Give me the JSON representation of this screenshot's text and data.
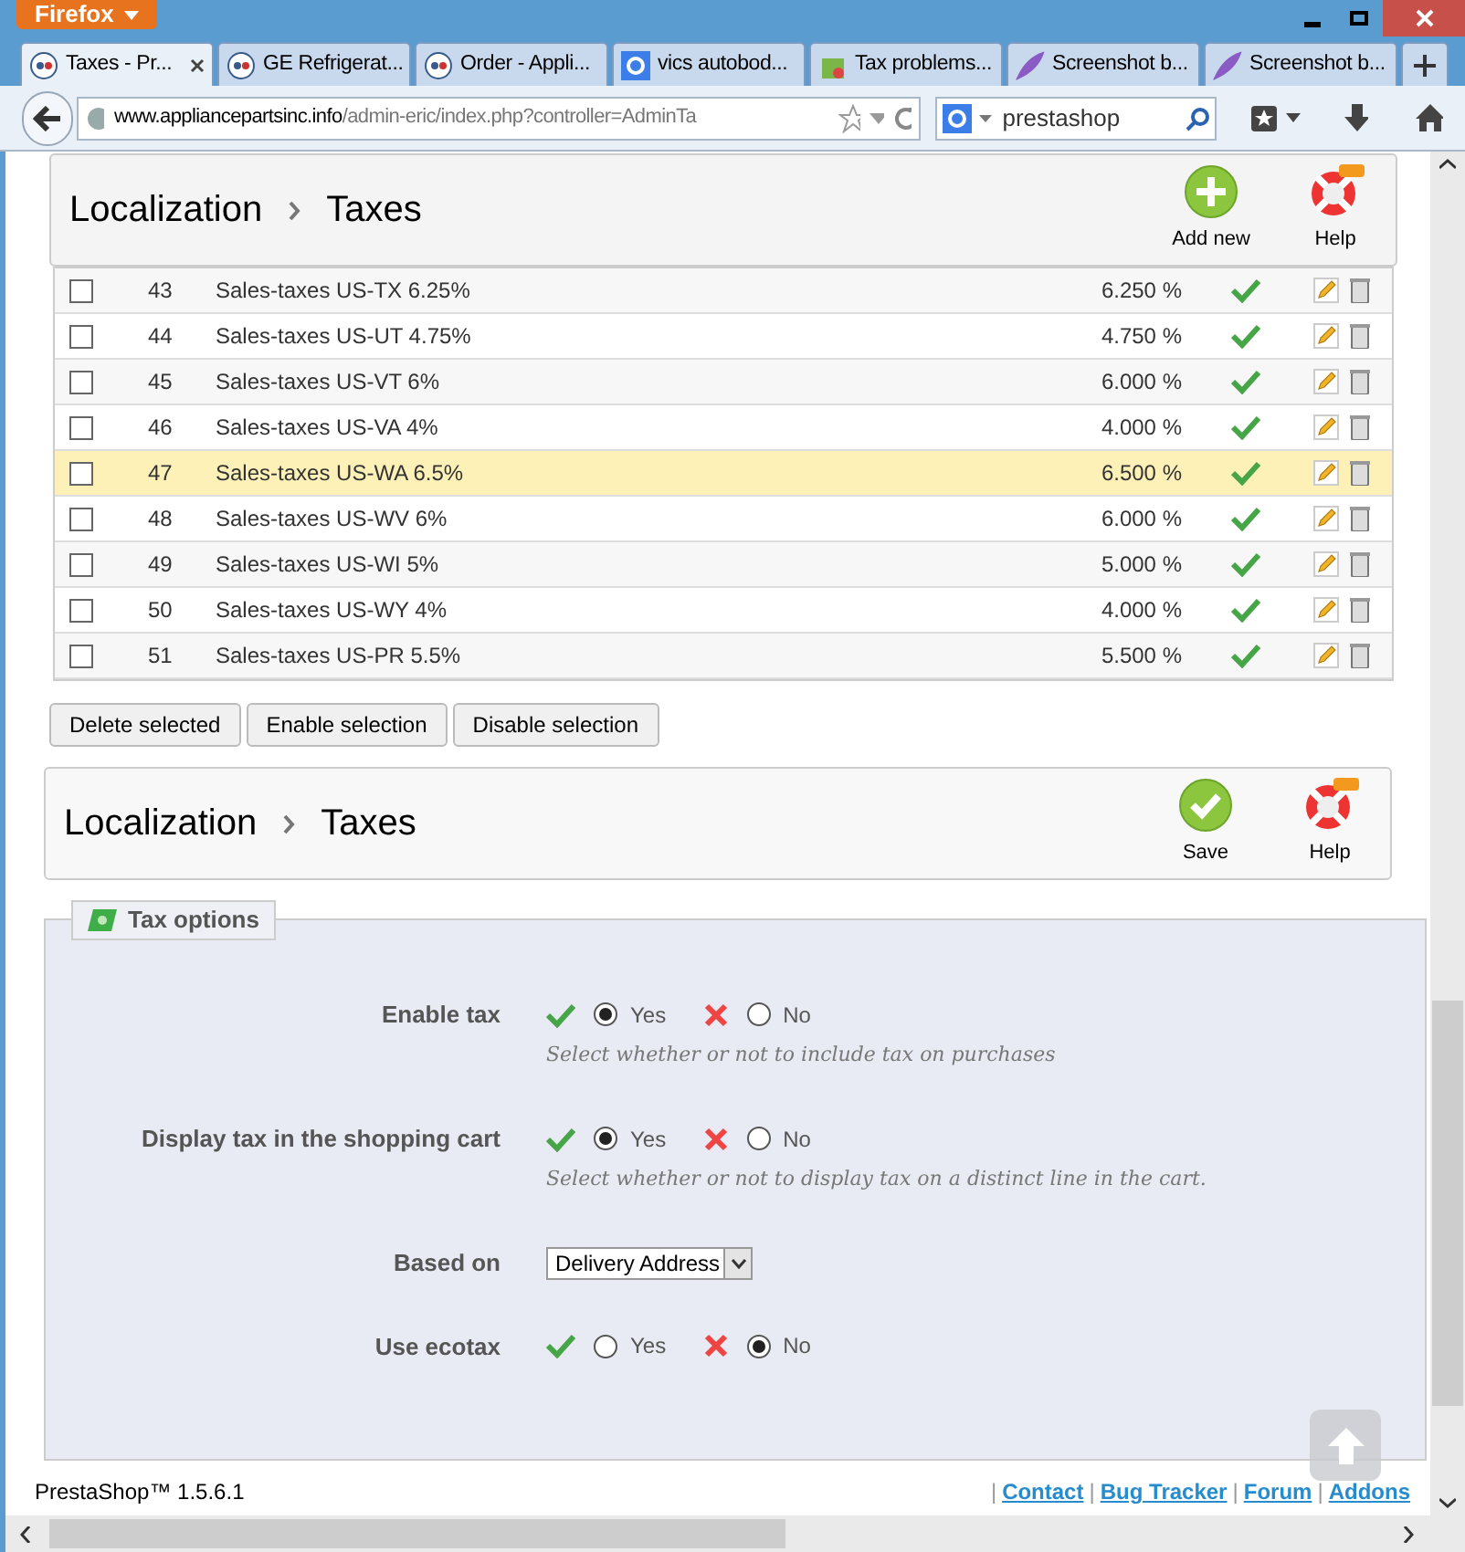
{
  "browser": {
    "menu_button": "Firefox",
    "tabs": [
      {
        "label": "Taxes - Pr...",
        "selected": true
      },
      {
        "label": "GE Refrigerat...",
        "selected": false
      },
      {
        "label": "Order - Appli...",
        "selected": false
      },
      {
        "label": "vics autobod...",
        "selected": false
      },
      {
        "label": "Tax problems...",
        "selected": false
      },
      {
        "label": "Screenshot b...",
        "selected": false
      },
      {
        "label": "Screenshot b...",
        "selected": false
      }
    ],
    "url_host": "www.appliancepartsinc.info",
    "url_path": "/admin-eric/index.php?controller=AdminTa",
    "search": {
      "value": "prestashop"
    }
  },
  "top_header": {
    "breadcrumb": [
      "Localization",
      "Taxes"
    ],
    "actions": [
      {
        "kind": "add",
        "label": "Add new"
      },
      {
        "kind": "help",
        "label": "Help"
      }
    ]
  },
  "table": {
    "rows": [
      {
        "id": "43",
        "name": "Sales-taxes US-TX 6.25%",
        "rate": "6.250 %",
        "enabled": true,
        "checked": false,
        "highlighted": false
      },
      {
        "id": "44",
        "name": "Sales-taxes US-UT 4.75%",
        "rate": "4.750 %",
        "enabled": true,
        "checked": false,
        "highlighted": false
      },
      {
        "id": "45",
        "name": "Sales-taxes US-VT 6%",
        "rate": "6.000 %",
        "enabled": true,
        "checked": false,
        "highlighted": false
      },
      {
        "id": "46",
        "name": "Sales-taxes US-VA 4%",
        "rate": "4.000 %",
        "enabled": true,
        "checked": false,
        "highlighted": false
      },
      {
        "id": "47",
        "name": "Sales-taxes US-WA 6.5%",
        "rate": "6.500 %",
        "enabled": true,
        "checked": false,
        "highlighted": true
      },
      {
        "id": "48",
        "name": "Sales-taxes US-WV 6%",
        "rate": "6.000 %",
        "enabled": true,
        "checked": false,
        "highlighted": false
      },
      {
        "id": "49",
        "name": "Sales-taxes US-WI 5%",
        "rate": "5.000 %",
        "enabled": true,
        "checked": false,
        "highlighted": false
      },
      {
        "id": "50",
        "name": "Sales-taxes US-WY 4%",
        "rate": "4.000 %",
        "enabled": true,
        "checked": false,
        "highlighted": false
      },
      {
        "id": "51",
        "name": "Sales-taxes US-PR 5.5%",
        "rate": "5.500 %",
        "enabled": true,
        "checked": false,
        "highlighted": false
      }
    ],
    "bulk_buttons": [
      "Delete selected",
      "Enable selection",
      "Disable selection"
    ]
  },
  "options_header": {
    "breadcrumb": [
      "Localization",
      "Taxes"
    ],
    "actions": [
      {
        "kind": "save",
        "label": "Save"
      },
      {
        "kind": "help",
        "label": "Help"
      }
    ]
  },
  "tax_options": {
    "legend": "Tax options",
    "fields": [
      {
        "kind": "toggle",
        "label": "Enable tax",
        "options": [
          {
            "label": "Yes",
            "selected": true
          },
          {
            "label": "No",
            "selected": false
          }
        ],
        "help": "Select whether or not to include tax on purchases"
      },
      {
        "kind": "toggle",
        "label": "Display tax in the shopping cart",
        "options": [
          {
            "label": "Yes",
            "selected": true
          },
          {
            "label": "No",
            "selected": false
          }
        ],
        "help": "Select whether or not to display tax on a distinct line in the cart."
      },
      {
        "kind": "select",
        "label": "Based on",
        "value": "Delivery Address"
      },
      {
        "kind": "toggle",
        "label": "Use ecotax",
        "options": [
          {
            "label": "Yes",
            "selected": false
          },
          {
            "label": "No",
            "selected": true
          }
        ]
      }
    ]
  },
  "footer": {
    "version": "PrestaShop™ 1.5.6.1",
    "links": [
      {
        "separator": "|",
        "label": "Contact"
      },
      {
        "separator": "|",
        "label": "Bug Tracker"
      },
      {
        "separator": "|",
        "label": "Forum"
      },
      {
        "separator": "|",
        "label": "Addons"
      }
    ]
  }
}
